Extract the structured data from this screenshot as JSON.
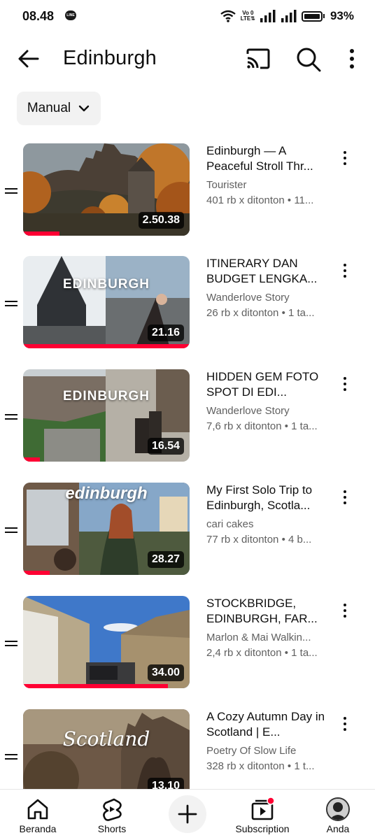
{
  "status_bar": {
    "time": "08.48",
    "volte": "Vo LTE",
    "battery": "93%"
  },
  "header": {
    "title": "Edinburgh",
    "back_icon": "arrow-left-icon",
    "cast_icon": "cast-icon",
    "search_icon": "search-icon",
    "more_icon": "more-vertical-icon"
  },
  "sort_chip": {
    "label": "Manual"
  },
  "videos": [
    {
      "title": "Edinburgh — A Peaceful Stroll Thr...",
      "channel": "Tourister",
      "views": "401 rb x ditonton • 11...",
      "duration": "2.50.38",
      "progress": 0.22
    },
    {
      "title": "ITINERARY DAN BUDGET LENGKA...",
      "channel": "Wanderlove Story",
      "views": "26 rb x ditonton • 1 ta...",
      "duration": "21.16",
      "progress": 1.0,
      "overlay": "EDINBURGH"
    },
    {
      "title": "HIDDEN GEM FOTO SPOT DI EDI...",
      "channel": "Wanderlove Story",
      "views": "7,6 rb x ditonton • 1 ta...",
      "duration": "16.54",
      "progress": 0.1,
      "overlay": "EDINBURGH"
    },
    {
      "title": "My First Solo Trip to Edinburgh, Scotla...",
      "channel": "cari cakes",
      "views": "77 rb x ditonton • 4 b...",
      "duration": "28.27",
      "progress": 0.16,
      "overlay": "edinburgh"
    },
    {
      "title": "STOCKBRIDGE, EDINBURGH, FAR...",
      "channel": "Marlon & Mai Walkin...",
      "views": "2,4 rb x ditonton • 1 ta...",
      "duration": "34.00",
      "progress": 0.87
    },
    {
      "title": "A Cozy Autumn Day in Scotland | E...",
      "channel": "Poetry Of Slow Life",
      "views": "328 rb x ditonton • 1 t...",
      "duration": "13.10",
      "progress": 0.0,
      "overlay": "Scotland"
    }
  ],
  "bottom_nav": {
    "home": "Beranda",
    "shorts": "Shorts",
    "subscriptions": "Subscription",
    "you": "Anda"
  },
  "colors": {
    "accent": "#ff0033",
    "chip_bg": "#f2f2f2",
    "secondary_text": "#606060"
  }
}
